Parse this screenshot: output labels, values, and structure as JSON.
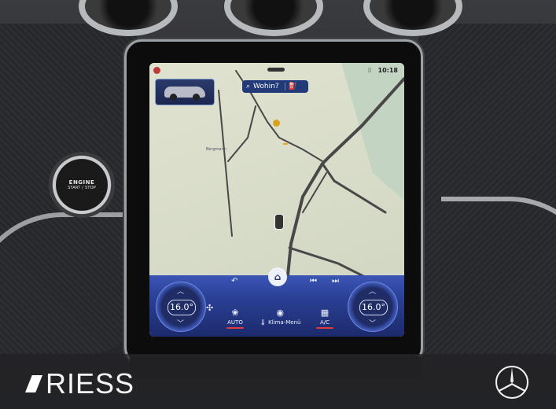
{
  "dashboard": {
    "start_button": {
      "line1": "ENGINE",
      "line2": "START / STOP"
    }
  },
  "screen": {
    "status": {
      "time": "10:18",
      "signal_icon": "sim-icon"
    },
    "search": {
      "label": "Wohin?",
      "icon": "search-icon",
      "secondary_icon": "fuel-pump-icon"
    },
    "map": {
      "place_label": "Bergmann"
    },
    "climate": {
      "left_temp": "16.0°",
      "right_temp": "16.0°",
      "auto_label": "AUTO",
      "menu_label": "Klima-Menü",
      "ac_label": "A/C",
      "accent_color": "#e23b3b"
    }
  },
  "branding": {
    "dealer": "RIESS",
    "logo": "mercedes-star"
  }
}
